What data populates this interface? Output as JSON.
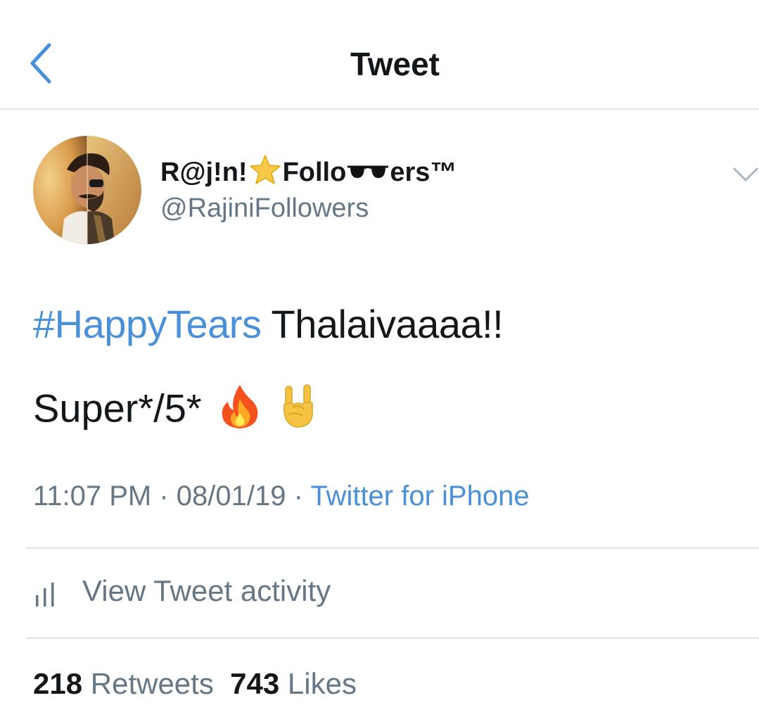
{
  "nav": {
    "title": "Tweet",
    "back_icon": "chevron-left-icon"
  },
  "author": {
    "display_name_part1": "R@j!n!",
    "display_name_part2": "Follo",
    "display_name_part3": "ers™",
    "star_emoji": "star-emoji",
    "sunglasses_emoji": "sunglasses-emoji",
    "handle": "@RajiniFollowers",
    "more_icon": "chevron-down-icon"
  },
  "tweet": {
    "hashtag": "#HappyTears",
    "text_line1": " Thalaivaaaa!!",
    "text_line2": "Super*/5*",
    "emoji_1": "fire-emoji",
    "emoji_2": "sign-of-the-horns-emoji"
  },
  "meta": {
    "time": "11:07 PM",
    "separator": " · ",
    "date": "08/01/19",
    "source": "Twitter for iPhone"
  },
  "activity": {
    "label": "View Tweet activity",
    "icon": "bar-chart-icon"
  },
  "stats": {
    "retweets_count": "218",
    "retweets_label": "Retweets",
    "likes_count": "743",
    "likes_label": "Likes"
  },
  "colors": {
    "link_blue": "#4a90d9",
    "text_dark": "#14171a",
    "text_gray": "#657786",
    "divider": "#e1e4e8"
  }
}
